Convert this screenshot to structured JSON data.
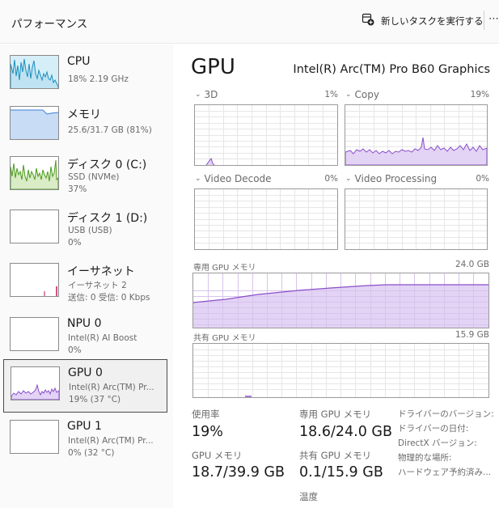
{
  "header": {
    "title": "パフォーマンス",
    "new_task_label": "新しいタスクを実行する",
    "more_label": "⋯"
  },
  "sidebar": {
    "items": [
      {
        "title": "CPU",
        "sub1": "18%  2.19 GHz",
        "sub2": "",
        "color": "#1a8fbf"
      },
      {
        "title": "メモリ",
        "sub1": "25.6/31.7 GB (81%)",
        "sub2": "",
        "color": "#3d7fd9"
      },
      {
        "title": "ディスク 0 (C:)",
        "sub1": "SSD (NVMe)",
        "sub2": "37%",
        "color": "#4d9a1e"
      },
      {
        "title": "ディスク 1 (D:)",
        "sub1": "USB (USB)",
        "sub2": "0%",
        "color": "#4d9a1e"
      },
      {
        "title": "イーサネット",
        "sub1": "イーサネット 2",
        "sub2": "送信: 0  受信: 0 Kbps",
        "color": "#c2185b"
      },
      {
        "title": "NPU 0",
        "sub1": "Intel(R) AI Boost",
        "sub2": "0%",
        "color": "#8a6ad0"
      },
      {
        "title": "GPU 0",
        "sub1": "Intel(R) Arc(TM) Pr...",
        "sub2": "19% (37 °C)",
        "color": "#8a4fc9"
      },
      {
        "title": "GPU 1",
        "sub1": "Intel(R) Arc(TM) Pr...",
        "sub2": "0% (32 °C)",
        "color": "#8a4fc9"
      }
    ]
  },
  "main": {
    "title": "GPU",
    "gpu_name": "Intel(R) Arc(TM) Pro B60 Graphics",
    "engines": [
      {
        "label": "3D",
        "pct": "1%"
      },
      {
        "label": "Copy",
        "pct": "19%"
      },
      {
        "label": "Video Decode",
        "pct": "0%"
      },
      {
        "label": "Video Processing",
        "pct": "0%"
      }
    ],
    "dedicated": {
      "label": "専用 GPU メモリ",
      "max": "24.0 GB"
    },
    "shared": {
      "label": "共有 GPU メモリ",
      "max": "15.9 GB"
    },
    "stats": {
      "utilization_label": "使用率",
      "utilization_value": "19%",
      "gpu_memory_label": "GPU メモリ",
      "gpu_memory_value": "18.7/39.9 GB",
      "dedicated_label": "専用 GPU メモリ",
      "dedicated_value": "18.6/24.0 GB",
      "shared_label": "共有 GPU メモリ",
      "shared_value": "0.1/15.9 GB",
      "temperature_label": "温度"
    },
    "info_labels": [
      "ドライバーのバージョン:",
      "ドライバーの日付:",
      "DirectX バージョン:",
      "物理的な場所:",
      "ハードウェア予約済み..."
    ]
  },
  "colors": {
    "gpu_accent": "#8a4fc9",
    "gpu_fill": "#e3d3f5",
    "grid": "#e6e6e6"
  }
}
